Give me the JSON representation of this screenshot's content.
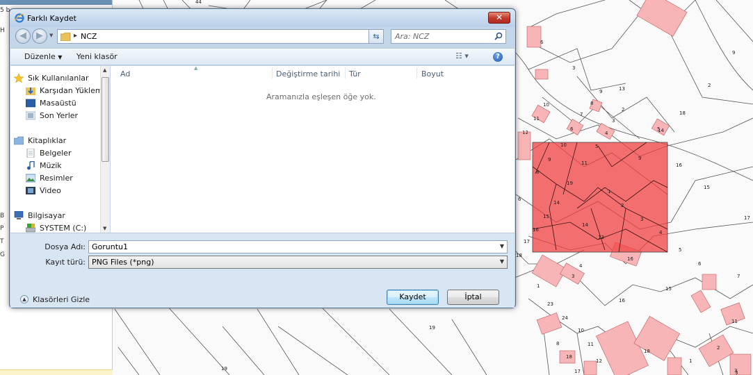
{
  "left_panel": {
    "top_label": "5 b",
    "labels": [
      "H",
      "B",
      "P",
      "T",
      "G"
    ]
  },
  "map": {
    "parcel_numbers": [
      "44",
      "6",
      "3",
      "9",
      "2",
      "13",
      "9",
      "10",
      "8",
      "2",
      "7",
      "3",
      "18",
      "11",
      "6",
      "4",
      "5",
      "12",
      "10",
      "5",
      "14",
      "9",
      "11",
      "9",
      "16",
      "19",
      "15",
      "8",
      "1",
      "6",
      "14",
      "2",
      "17",
      "15",
      "3",
      "4",
      "16",
      "14",
      "13",
      "5",
      "17",
      "18",
      "16",
      "6",
      "4",
      "3",
      "7",
      "1",
      "15",
      "23",
      "16",
      "24",
      "10",
      "11",
      "8",
      "19",
      "11",
      "18",
      "2",
      "18",
      "12",
      "17",
      "1",
      "3",
      "3",
      "19"
    ]
  },
  "dialog": {
    "title": "Farklı Kaydet",
    "close_label": "✕",
    "address": "NCZ",
    "search_placeholder": "Ara: NCZ",
    "toolbar": {
      "organize": "Düzenle",
      "new_folder": "Yeni klasör"
    },
    "nav_items": [
      {
        "label": "Sık Kullanılanlar",
        "icon": "star-icon"
      },
      {
        "label": "Karşıdan Yüklem",
        "icon": "downloads-icon"
      },
      {
        "label": "Masaüstü",
        "icon": "desktop-icon"
      },
      {
        "label": "Son Yerler",
        "icon": "recent-places-icon"
      },
      {
        "label": "Kitaplıklar",
        "icon": "libraries-icon"
      },
      {
        "label": "Belgeler",
        "icon": "documents-icon"
      },
      {
        "label": "Müzik",
        "icon": "music-icon"
      },
      {
        "label": "Resimler",
        "icon": "pictures-icon"
      },
      {
        "label": "Video",
        "icon": "video-icon"
      },
      {
        "label": "Bilgisayar",
        "icon": "computer-icon"
      },
      {
        "label": "SYSTEM (C:)",
        "icon": "drive-icon"
      }
    ],
    "columns": [
      "Ad",
      "Değiştirme tarihi",
      "Tür",
      "Boyut"
    ],
    "empty_message": "Aramanızla eşleşen öğe yok.",
    "filename_label": "Dosya Adı:",
    "filename_value": "Goruntu1",
    "filetype_label": "Kayıt türü:",
    "filetype_value": "PNG Files (*png)",
    "hide_folders": "Klasörleri Gizle",
    "save_button": "Kaydet",
    "cancel_button": "İptal"
  },
  "colors": {
    "parcel_fill": "#f7b5b8",
    "selection_fill": "#f04040",
    "dialog_frame": "#c4d6ea"
  }
}
